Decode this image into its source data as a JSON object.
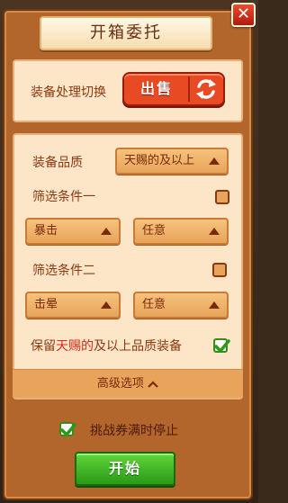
{
  "dialog": {
    "title": "开箱委托",
    "close_icon": "close-x-icon"
  },
  "equipment_handling": {
    "label": "装备处理切换",
    "mode_label": "出售",
    "swap_icon": "swap-arrows-icon"
  },
  "filters": {
    "quality_label": "装备品质",
    "quality_value": "天赐的及以上",
    "condition1_label": "筛选条件一",
    "condition1_checked": false,
    "condition1_stat": "暴击",
    "condition1_value": "任意",
    "condition2_label": "筛选条件二",
    "condition2_checked": false,
    "condition2_stat": "击晕",
    "condition2_value": "任意",
    "keep_prefix": "保留",
    "keep_highlight": "天赐的",
    "keep_suffix": "及以上品质装备",
    "keep_checked": true,
    "advanced_label": "高级选项",
    "advanced_icon": "chevron-up-icon"
  },
  "footer": {
    "stop_label": "挑战券满时停止",
    "stop_checked": true,
    "start_label": "开始"
  },
  "colors": {
    "accent_red": "#e84a24",
    "highlight_red": "#e0281a",
    "start_green": "#2a9a18",
    "panel_bg": "#fde6c8"
  }
}
